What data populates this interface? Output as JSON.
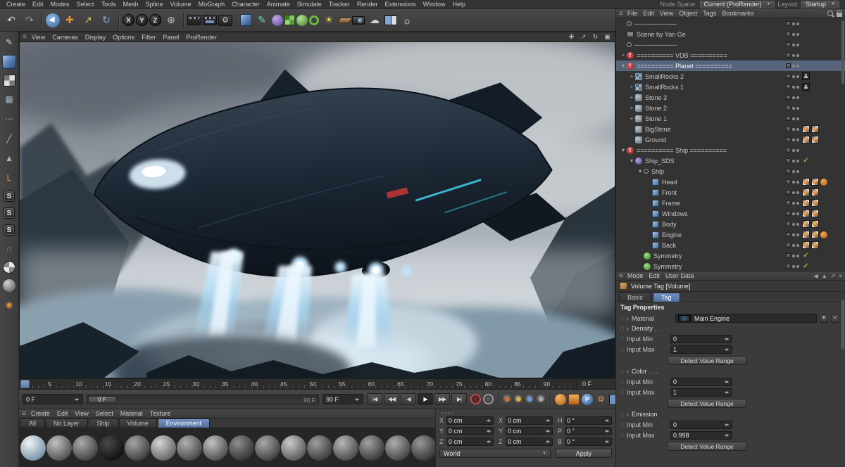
{
  "menubar": {
    "items": [
      "Create",
      "Edit",
      "Modes",
      "Select",
      "Tools",
      "Mesh",
      "Spline",
      "Volume",
      "MoGraph",
      "Character",
      "Animate",
      "Simulate",
      "Tracker",
      "Render",
      "Extensions",
      "Window",
      "Help"
    ],
    "node_space_label": "Node Space:",
    "node_space_value": "Current (ProRender)",
    "layout_label": "Layout:",
    "layout_value": "Startup"
  },
  "toolbar": {
    "buttons": [
      {
        "n": "undo-icon",
        "g": "↶",
        "fg": "#d8d8d8"
      },
      {
        "n": "redo-icon",
        "g": "↷",
        "fg": "#8f8f8f"
      },
      {
        "sep": true
      },
      {
        "n": "live-selection-icon",
        "cls": "sel-cursor"
      },
      {
        "n": "move-tool-icon",
        "g": "✚",
        "fg": "#e0913c"
      },
      {
        "n": "scale-tool-icon",
        "g": "↗",
        "fg": "#d9c24a"
      },
      {
        "n": "rotate-tool-icon",
        "g": "↻",
        "fg": "#7fb2e0"
      },
      {
        "sep": true
      },
      {
        "n": "x-axis-button",
        "g": "X",
        "cls": "axis"
      },
      {
        "n": "y-axis-button",
        "g": "Y",
        "cls": "axis"
      },
      {
        "n": "z-axis-button",
        "g": "Z",
        "cls": "axis"
      },
      {
        "n": "coordinate-system-icon",
        "g": "⊕",
        "fg": "#c0c0c0"
      },
      {
        "sep": true
      },
      {
        "n": "render-view-icon",
        "cls": "clapper"
      },
      {
        "n": "render-picture-viewer-icon",
        "cls": "clapper pv"
      },
      {
        "n": "render-settings-icon",
        "g": "⚙",
        "cls": "chip"
      },
      {
        "sep": true
      },
      {
        "n": "primitive-cube-icon",
        "cls": "cube-b"
      },
      {
        "n": "spline-pen-icon",
        "g": "✎",
        "fg": "#6fd3c3"
      },
      {
        "n": "subdivision-surface-icon",
        "cls": "ball-v"
      },
      {
        "n": "mograph-cloner-icon",
        "cls": "cloner-g"
      },
      {
        "n": "volume-builder-icon",
        "cls": "ball-g"
      },
      {
        "n": "field-icon",
        "cls": "ring-g"
      },
      {
        "n": "light-icon",
        "g": "☀",
        "fg": "#e8d44d"
      },
      {
        "n": "floor-icon",
        "cls": "floor-i"
      },
      {
        "n": "camera-icon",
        "cls": "cam-i"
      },
      {
        "n": "sky-icon",
        "g": "☁",
        "fg": "#ccd3da"
      },
      {
        "n": "view-panes-icon",
        "cls": "panes-i"
      },
      {
        "n": "bulb-icon",
        "g": "☼",
        "fg": "#f0f0f0"
      }
    ]
  },
  "left_toolbar": {
    "buttons": [
      {
        "n": "make-editable-icon",
        "g": "✎",
        "fg": "#cfcfcf"
      },
      {
        "n": "model-mode-icon",
        "cls": "cube-b"
      },
      {
        "n": "texture-mode-icon",
        "cls": "checker-i"
      },
      {
        "n": "workplane-mode-icon",
        "g": "▦",
        "fg": "#9fb6c9"
      },
      {
        "n": "points-mode-icon",
        "g": "⋯",
        "fg": "#9fb6c9"
      },
      {
        "n": "edges-mode-icon",
        "g": "╱",
        "fg": "#9fb6c9"
      },
      {
        "n": "polygons-mode-icon",
        "g": "▲",
        "fg": "#9fb6c9"
      },
      {
        "n": "enable-axis-icon",
        "g": "L",
        "fg": "#e0913c"
      },
      {
        "n": "selection-filter-1-icon",
        "g": "S",
        "cls": "sbadge"
      },
      {
        "n": "selection-filter-2-icon",
        "g": "S",
        "cls": "sbadge"
      },
      {
        "n": "selection-filter-3-icon",
        "g": "S",
        "cls": "sbadge"
      },
      {
        "n": "snap-icon",
        "g": "∩",
        "fg": "#d86a3a"
      },
      {
        "n": "texture-ball-icon",
        "cls": "checker-ball"
      },
      {
        "n": "workplane-ball-icon",
        "cls": "gray-ball"
      },
      {
        "n": "axis-band-icon",
        "g": "◉",
        "fg": "#e0913c"
      }
    ]
  },
  "viewport": {
    "menu_items": [
      "View",
      "Cameras",
      "Display",
      "Options",
      "Filter",
      "Panel",
      "ProRender"
    ]
  },
  "timeline": {
    "labels": [
      "5",
      "10",
      "15",
      "20",
      "25",
      "30",
      "35",
      "40",
      "45",
      "50",
      "55",
      "60",
      "65",
      "70",
      "75",
      "80",
      "85",
      "90"
    ],
    "end_label": "0 F",
    "frame_min": 0,
    "frame_max": 90
  },
  "transport": {
    "current_frame": "0 F",
    "slider_start_label": "0 F",
    "slider_end_label": "90 F",
    "end_frame_field": "90 F",
    "buttons": [
      {
        "n": "jump-start-button",
        "g": "|◀"
      },
      {
        "n": "prev-key-button",
        "g": "◀◀"
      },
      {
        "n": "prev-frame-button",
        "g": "◀"
      },
      {
        "n": "play-button",
        "g": "▶",
        "cls": "active"
      },
      {
        "n": "next-frame-button",
        "g": "▶▶"
      },
      {
        "n": "jump-end-button",
        "g": "▶|"
      }
    ],
    "right_buttons": [
      {
        "n": "record-button",
        "cls": "rec"
      },
      {
        "n": "autokey-button",
        "cls": "rec2"
      },
      {
        "sep": true
      },
      {
        "n": "keyframe-position-icon",
        "cls": "kf kp"
      },
      {
        "n": "keyframe-scale-icon",
        "cls": "kf ks"
      },
      {
        "n": "keyframe-rotation-icon",
        "cls": "kf kr"
      },
      {
        "n": "keyframe-parameter-icon",
        "cls": "kf kpar"
      },
      {
        "sep": true
      },
      {
        "n": "render-view-button",
        "cls": "rv"
      },
      {
        "n": "render-picture-viewer-button",
        "cls": "rpv"
      },
      {
        "n": "prorender-button",
        "g": "P",
        "cls": "pro"
      },
      {
        "n": "render-settings-button",
        "g": "⚙",
        "fg": "#e0a23c"
      },
      {
        "n": "layout-panes-icon",
        "cls": "panes2"
      }
    ]
  },
  "materials": {
    "menu_items": [
      "Create",
      "Edit",
      "View",
      "Select",
      "Material",
      "Texture"
    ],
    "tabs": [
      "All",
      "No Layer",
      "Ship",
      "Volume",
      "Environment"
    ],
    "active_tab": "Environment",
    "spheres": [
      {
        "hi": "#f0f5f8",
        "lo": "#7e99ad"
      },
      {
        "hi": "#c2c2c2",
        "lo": "#565656"
      },
      {
        "hi": "#ababab",
        "lo": "#474747"
      },
      {
        "hi": "#4a4a4a",
        "lo": "#141414"
      },
      {
        "hi": "#a5a5a5",
        "lo": "#444444"
      },
      {
        "hi": "#d5d5d5",
        "lo": "#6a6a6a"
      },
      {
        "hi": "#b0b0b0",
        "lo": "#4e4e4e"
      },
      {
        "hi": "#c4c4c4",
        "lo": "#525252"
      },
      {
        "hi": "#8e8e8e",
        "lo": "#383838"
      },
      {
        "hi": "#a8a8a8",
        "lo": "#464646"
      },
      {
        "hi": "#cccccc",
        "lo": "#5e5e5e"
      },
      {
        "hi": "#9e9e9e",
        "lo": "#414141"
      },
      {
        "hi": "#b8b8b8",
        "lo": "#4f4f4f"
      },
      {
        "hi": "#a2a2a2",
        "lo": "#3f3f3f"
      },
      {
        "hi": "#adadad",
        "lo": "#4a4a4a"
      },
      {
        "hi": "#989898",
        "lo": "#3a3a3a"
      }
    ]
  },
  "coordinates": {
    "columns": [
      {
        "name": "position",
        "rows": [
          {
            "label": "X",
            "value": "0 cm"
          },
          {
            "label": "Y",
            "value": "0 cm"
          },
          {
            "label": "Z",
            "value": "0 cm"
          }
        ]
      },
      {
        "name": "size",
        "rows": [
          {
            "label": "X",
            "value": "0 cm"
          },
          {
            "label": "Y",
            "value": "0 cm"
          },
          {
            "label": "Z",
            "value": "0 cm"
          }
        ]
      },
      {
        "name": "rotation",
        "rows": [
          {
            "label": "H",
            "value": "0 °"
          },
          {
            "label": "P",
            "value": "0 °"
          },
          {
            "label": "B",
            "value": "0 °"
          }
        ]
      }
    ],
    "space_value": "World",
    "apply_label": "Apply"
  },
  "object_manager": {
    "menu_items": [
      "File",
      "Edit",
      "View",
      "Object",
      "Tags",
      "Bookmarks"
    ],
    "items": [
      {
        "label": "--------------------",
        "icon": "null",
        "indent": 0,
        "expand": "",
        "tags": []
      },
      {
        "label": "Scene by Yan Ge",
        "icon": "scene",
        "indent": 0,
        "expand": "",
        "tags": []
      },
      {
        "label": "--------------------",
        "icon": "null",
        "indent": 0,
        "expand": "",
        "tags": []
      },
      {
        "label": "========== VDB ==========",
        "icon": "warn",
        "indent": 0,
        "expand": "plus",
        "tags": []
      },
      {
        "label": "========== Planet ==========",
        "icon": "warn",
        "indent": 0,
        "expand": "open",
        "sel": true,
        "tags": []
      },
      {
        "label": "SmallRocks 2",
        "icon": "cloner",
        "indent": 1,
        "expand": "plus",
        "tags": [
          "person"
        ]
      },
      {
        "label": "SmallRocks 1",
        "icon": "cloner",
        "indent": 1,
        "expand": "plus",
        "tags": [
          "person"
        ]
      },
      {
        "label": "Stone 3",
        "icon": "stone",
        "indent": 1,
        "expand": "plus",
        "tags": []
      },
      {
        "label": "Stone 2",
        "icon": "stone",
        "indent": 1,
        "expand": "plus",
        "tags": []
      },
      {
        "label": "Stone 1",
        "icon": "stone",
        "indent": 1,
        "expand": "plus",
        "tags": []
      },
      {
        "label": "BigStone",
        "icon": "stone",
        "indent": 1,
        "expand": "",
        "tags": [
          "mat",
          "mat"
        ]
      },
      {
        "label": "Ground",
        "icon": "stone",
        "indent": 1,
        "expand": "",
        "tags": [
          "mat",
          "mat"
        ]
      },
      {
        "label": "========== Ship ==========",
        "icon": "warn",
        "indent": 0,
        "expand": "open",
        "tags": []
      },
      {
        "label": "Ship_SDS",
        "icon": "sds",
        "indent": 1,
        "expand": "open",
        "tags": [
          "check"
        ]
      },
      {
        "label": "Ship",
        "icon": "null",
        "indent": 2,
        "expand": "open",
        "tags": []
      },
      {
        "label": "Head",
        "icon": "mesh",
        "indent": 3,
        "expand": "",
        "tags": [
          "mat",
          "mat",
          "orange"
        ]
      },
      {
        "label": "Front",
        "icon": "mesh",
        "indent": 3,
        "expand": "",
        "tags": [
          "mat",
          "mat"
        ]
      },
      {
        "label": "Frame",
        "icon": "mesh",
        "indent": 3,
        "expand": "",
        "tags": [
          "mat",
          "mat"
        ]
      },
      {
        "label": "Windows",
        "icon": "mesh",
        "indent": 3,
        "expand": "",
        "tags": [
          "mat",
          "mat"
        ]
      },
      {
        "label": "Body",
        "icon": "mesh",
        "indent": 3,
        "expand": "",
        "tags": [
          "mat",
          "mat"
        ]
      },
      {
        "label": "Engine",
        "icon": "mesh",
        "indent": 3,
        "expand": "",
        "tags": [
          "mat",
          "mat",
          "orange"
        ]
      },
      {
        "label": "Back",
        "icon": "mesh",
        "indent": 3,
        "expand": "",
        "tags": [
          "mat",
          "mat"
        ]
      },
      {
        "label": "Symmetry",
        "icon": "sym",
        "indent": 2,
        "expand": "",
        "tags": [
          "check"
        ]
      },
      {
        "label": "Symmetry",
        "icon": "sym",
        "indent": 2,
        "expand": "",
        "tags": [
          "check"
        ]
      }
    ]
  },
  "attributes": {
    "menu_items": [
      "Mode",
      "Edit",
      "User Data"
    ],
    "title": "Volume Tag [Volume]",
    "tabs": [
      "Basic",
      "Tag"
    ],
    "active_tab": "Tag",
    "section_title": "Tag Properties",
    "material_label": "Material",
    "material_value": "Main Engine",
    "groups": [
      {
        "label": "Density . .",
        "rows": [
          {
            "label": "Input Min",
            "value": "0"
          },
          {
            "label": "Input Max",
            "value": "1"
          }
        ],
        "button": "Detect Value Range"
      },
      {
        "label": "Color . . .",
        "rows": [
          {
            "label": "Input Min",
            "value": "0"
          },
          {
            "label": "Input Max",
            "value": "1"
          }
        ],
        "button": "Detect Value Range"
      },
      {
        "label": "Emission",
        "rows": [
          {
            "label": "Input Min",
            "value": "0"
          },
          {
            "label": "Input Max",
            "value": "0.998"
          }
        ],
        "button": "Detect Value Range"
      }
    ]
  }
}
